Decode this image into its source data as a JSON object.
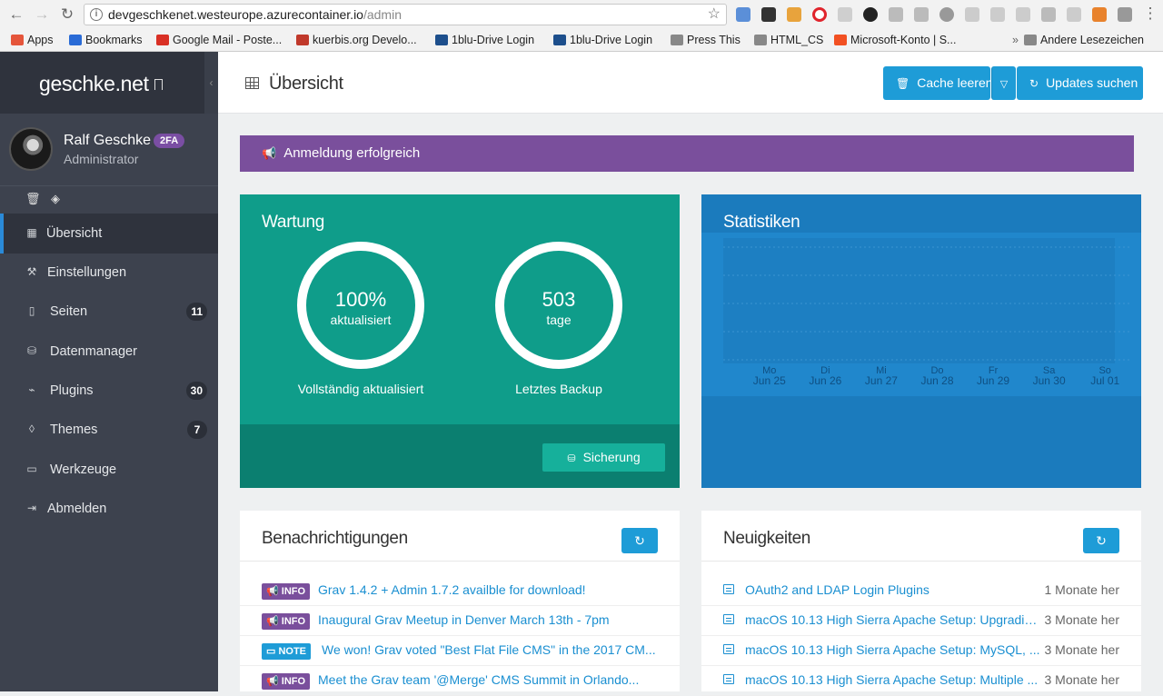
{
  "browser": {
    "url_host": "devgeschkenet.westeurope.azurecontainer.io",
    "url_path": "/admin",
    "bookmarks": [
      {
        "label": "Apps",
        "color": "#e5553b"
      },
      {
        "label": "Bookmarks",
        "color": "#2a6bd6"
      },
      {
        "label": "Google Mail - Poste...",
        "color": "#d93025"
      },
      {
        "label": "kuerbis.org Develo...",
        "color": "#c0392b"
      },
      {
        "label": "1blu-Drive Login",
        "color": "#1d4f8c"
      },
      {
        "label": "1blu-Drive Login",
        "color": "#1d4f8c"
      },
      {
        "label": "Press This",
        "color": "#888888"
      },
      {
        "label": "HTML_CS",
        "color": "#888888"
      },
      {
        "label": "Microsoft-Konto | S...",
        "color": "#f25022"
      },
      {
        "label": "Andere Lesezeichen",
        "color": "#888888"
      }
    ]
  },
  "sidebar": {
    "brand": "geschke.net",
    "user": {
      "name": "Ralf Geschke",
      "badge": "2FA",
      "role": "Administrator"
    },
    "items": [
      {
        "label": "Übersicht",
        "icon": "grid-icon"
      },
      {
        "label": "Einstellungen",
        "icon": "wrench-icon"
      },
      {
        "label": "Seiten",
        "icon": "file-icon",
        "count": "11"
      },
      {
        "label": "Datenmanager",
        "icon": "database-icon"
      },
      {
        "label": "Plugins",
        "icon": "plug-icon",
        "count": "30"
      },
      {
        "label": "Themes",
        "icon": "tint-icon",
        "count": "7"
      },
      {
        "label": "Werkzeuge",
        "icon": "toolbox-icon"
      },
      {
        "label": "Abmelden",
        "icon": "logout-icon"
      }
    ]
  },
  "header": {
    "title": "Übersicht",
    "cache_label": "Cache leeren",
    "updates_label": "Updates suchen"
  },
  "alert": {
    "text": "Anmeldung erfolgreich"
  },
  "maintenance": {
    "title": "Wartung",
    "updated_value": "100%",
    "updated_unit": "aktualisiert",
    "updated_label": "Vollständig aktualisiert",
    "backup_value": "503",
    "backup_unit": "tage",
    "backup_label": "Letztes Backup",
    "backup_button": "Sicherung"
  },
  "stats": {
    "title": "Statistiken",
    "chart_data": {
      "type": "bar",
      "categories": [
        {
          "day": "Mo",
          "date": "Jun 25"
        },
        {
          "day": "Di",
          "date": "Jun 26"
        },
        {
          "day": "Mi",
          "date": "Jun 27"
        },
        {
          "day": "Do",
          "date": "Jun 28"
        },
        {
          "day": "Fr",
          "date": "Jun 29"
        },
        {
          "day": "Sa",
          "date": "Jun 30"
        },
        {
          "day": "So",
          "date": "Jul 01"
        }
      ],
      "values": [
        0,
        0,
        0,
        0,
        0,
        0,
        0
      ]
    }
  },
  "notifications": {
    "title": "Benachrichtigungen",
    "items": [
      {
        "type": "INFO",
        "text": "Grav 1.4.2 + Admin 1.7.2 availble for download!"
      },
      {
        "type": "INFO",
        "text": "Inaugural Grav Meetup in Denver March 13th - 7pm"
      },
      {
        "type": "NOTE",
        "text": "We won! Grav voted \"Best Flat File CMS\" in the 2017 CM..."
      },
      {
        "type": "INFO",
        "text": "Meet the Grav team '@Merge' CMS Summit in Orlando..."
      }
    ]
  },
  "news": {
    "title": "Neuigkeiten",
    "items": [
      {
        "text": "OAuth2 and LDAP Login Plugins",
        "ago": "1 Monate her"
      },
      {
        "text": "macOS 10.13 High Sierra Apache Setup: Upgradin...",
        "ago": "3 Monate her"
      },
      {
        "text": "macOS 10.13 High Sierra Apache Setup: MySQL, ...",
        "ago": "3 Monate her"
      },
      {
        "text": "macOS 10.13 High Sierra Apache Setup: Multiple ...",
        "ago": "3 Monate her"
      }
    ]
  }
}
